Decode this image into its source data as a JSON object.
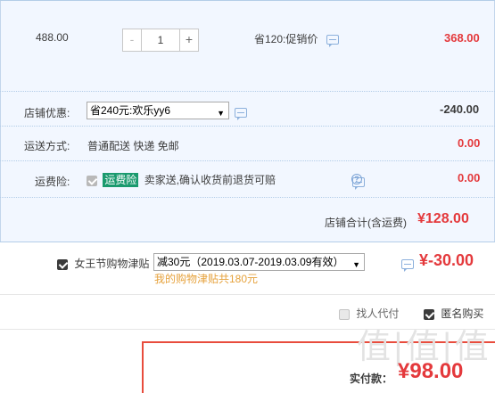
{
  "item": {
    "unit_price": "488.00",
    "quantity_minus": "-",
    "quantity": "1",
    "quantity_plus": "+",
    "promo_text": "省120:促销价",
    "subtotal": "368.00"
  },
  "shop_discount": {
    "label": "店铺优惠:",
    "selected": "省240元:欢乐yy6",
    "amount": "-240.00"
  },
  "shipping": {
    "label": "运送方式:",
    "method": "普通配送 快递 免邮",
    "amount": "0.00"
  },
  "shipping_insurance": {
    "label": "运费险:",
    "badge": "运费险",
    "text": "卖家送,确认收货前退货可赔",
    "amount": "0.00"
  },
  "shop_total": {
    "label": "店铺合计(含运费)",
    "amount": "¥128.00"
  },
  "allowance": {
    "label": "女王节购物津贴",
    "selected": "减30元（2019.03.07-2019.03.09有效）",
    "amount": "¥-30.00",
    "note": "我的购物津贴共180元"
  },
  "options": {
    "proxy_pay": "找人代付",
    "anonymous": "匿名购买"
  },
  "payment": {
    "label": "实付款：",
    "amount": "¥98.00"
  },
  "watermark": "值|值|值",
  "colors": {
    "accent_red": "#e4393c",
    "zone_blue": "#f2f7ff",
    "badge_green": "#1a9a6e",
    "note_orange": "#e6a23c"
  }
}
